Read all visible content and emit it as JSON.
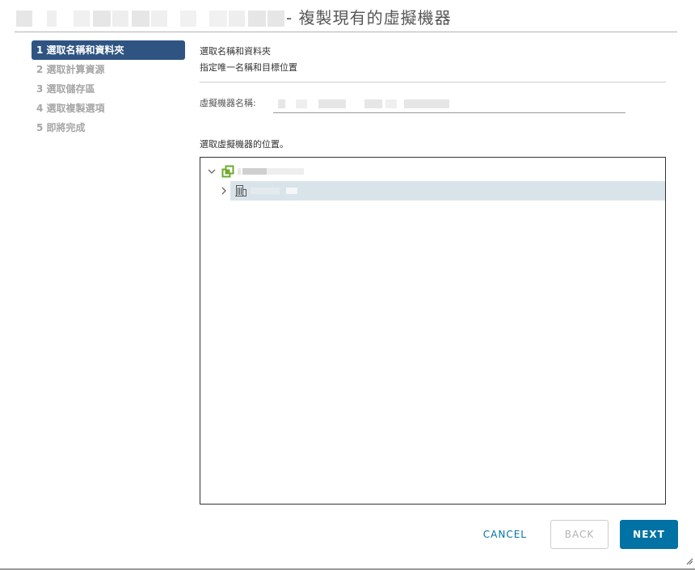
{
  "dialog": {
    "title": "- 複製現有的虛擬機器"
  },
  "steps": [
    {
      "label": "1 選取名稱和資料夾",
      "active": true
    },
    {
      "label": "2 選取計算資源",
      "active": false
    },
    {
      "label": "3 選取儲存區",
      "active": false
    },
    {
      "label": "4 選取複製選項",
      "active": false
    },
    {
      "label": "5 即將完成",
      "active": false
    }
  ],
  "content": {
    "heading": "選取名稱和資料夾",
    "subheading": "指定唯一名稱和目標位置",
    "vm_name_label": "虛擬機器名稱:",
    "vm_name_value": "",
    "location_label": "選取虛擬機器的位置。"
  },
  "tree": {
    "root": {
      "icon": "vcenter-icon",
      "expanded": true
    },
    "child": {
      "icon": "datacenter-icon",
      "expanded": false,
      "selected": true
    }
  },
  "buttons": {
    "cancel": "CANCEL",
    "back": "BACK",
    "next": "NEXT"
  },
  "colors": {
    "accent": "#0072a3",
    "active_step": "#2f5482",
    "selected_row": "#d9e4ea",
    "vcenter_icon": "#6cab2c"
  }
}
